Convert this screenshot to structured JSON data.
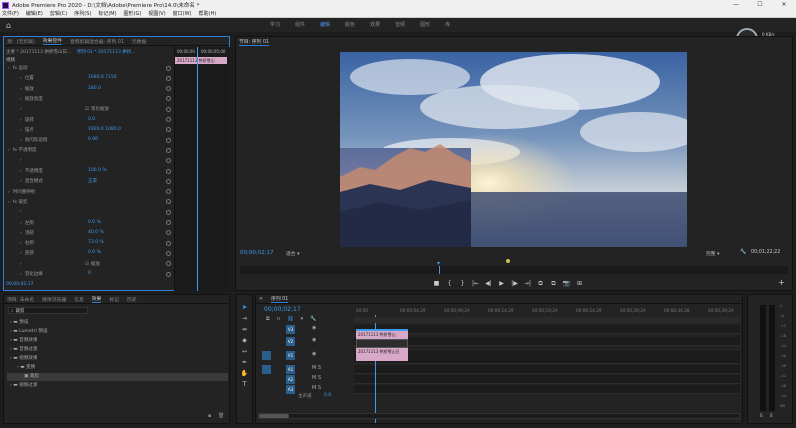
{
  "window": {
    "title": "Adobe Premiere Pro 2020 - D:\\文档\\Adobe\\Premiere Pro\\14.0\\未命名 *",
    "min": "—",
    "max": "☐",
    "close": "✕"
  },
  "menu": [
    "文件(F)",
    "编辑(E)",
    "剪辑(C)",
    "序列(S)",
    "标记(M)",
    "图形(G)",
    "视图(V)",
    "窗口(W)",
    "帮助(H)"
  ],
  "workspace": {
    "home_icon": "home-icon",
    "tabs": [
      "学习",
      "组件",
      "编辑",
      "颜色",
      "效果",
      "音频",
      "图形",
      "库"
    ],
    "active_tab": "编辑",
    "badge": "63",
    "badge_stats": [
      "0 KB/s",
      "0 KB/s"
    ]
  },
  "effect_controls": {
    "tabs": [
      "源：(无剪辑)",
      "效果控件",
      "音频剪辑混合器: 序列 01",
      "元数据"
    ],
    "source_line": "主要 * 20171113 拱桥雪山日...",
    "sequence_line": "序列 01 * 20171113 拱桥...",
    "video_label": "视频",
    "clip_in_timeline": "20171113 拱桥雪山",
    "timecode_in": "00;00;00",
    "timecode_out": "00;00;05;00",
    "rows": [
      {
        "label": "fx  运动",
        "indent": 0,
        "value": ""
      },
      {
        "label": "位置",
        "indent": 1,
        "value": "1680.0    7150"
      },
      {
        "label": "缩放",
        "indent": 1,
        "value": "180.0"
      },
      {
        "label": "缩放宽度",
        "indent": 1,
        "value": ""
      },
      {
        "label": "",
        "indent": 1,
        "value": "",
        "checkbox": "等比缩放"
      },
      {
        "label": "旋转",
        "indent": 1,
        "value": "0.0"
      },
      {
        "label": "锚点",
        "indent": 1,
        "value": "1920.0    1080.0"
      },
      {
        "label": "防闪烁滤镜",
        "indent": 1,
        "value": "0.00"
      },
      {
        "label": "fx  不透明度",
        "indent": 0,
        "value": ""
      },
      {
        "label": "",
        "indent": 1,
        "value": ""
      },
      {
        "label": "不透明度",
        "indent": 1,
        "value": "100.0 %"
      },
      {
        "label": "混合模式",
        "indent": 1,
        "value": "正常"
      },
      {
        "label": "时间重映射",
        "indent": 0,
        "value": ""
      },
      {
        "label": "fx  裁剪",
        "indent": 0,
        "value": ""
      },
      {
        "label": "",
        "indent": 1,
        "value": ""
      },
      {
        "label": "左侧",
        "indent": 1,
        "value": "0.0 %"
      },
      {
        "label": "顶部",
        "indent": 1,
        "value": "40.0 %"
      },
      {
        "label": "右侧",
        "indent": 1,
        "value": "73.0 %"
      },
      {
        "label": "底部",
        "indent": 1,
        "value": "0.0 %"
      },
      {
        "label": "",
        "indent": 1,
        "value": "",
        "checkbox": "缩放"
      },
      {
        "label": "羽化边缘",
        "indent": 1,
        "value": "0"
      }
    ],
    "bottom_time": "00;00;02;17"
  },
  "program": {
    "title": "节目: 序列 01",
    "timecode": "00;00;02;17",
    "fit": "适合",
    "quality": "完整",
    "duration": "00;01;22;22",
    "transport": [
      "■",
      "{",
      "}",
      "|←",
      "◀|",
      "▶",
      "|▶",
      "→|",
      "⧉",
      "⧉",
      "📷",
      "⊞"
    ],
    "add": "+"
  },
  "project": {
    "tabs": [
      "项目: 未命名",
      "媒体浏览器",
      "信息",
      "效果",
      "标记",
      "历史"
    ],
    "search_placeholder": "裁剪",
    "tree": [
      {
        "label": "预设",
        "indent": 0
      },
      {
        "label": "Lumetri 预设",
        "indent": 0
      },
      {
        "label": "音频效果",
        "indent": 0
      },
      {
        "label": "音频过渡",
        "indent": 0
      },
      {
        "label": "视频效果",
        "indent": 0
      },
      {
        "label": "变换",
        "indent": 1
      },
      {
        "label": "裁剪",
        "indent": 2,
        "selected": true
      },
      {
        "label": "视频过渡",
        "indent": 0
      }
    ]
  },
  "timeline": {
    "tab": "序列 01",
    "timecode": "00;00;02;17",
    "ruler": [
      "00;00",
      "00;00;04;29",
      "00;00;09;29",
      "00;00;14;29",
      "00;00;19;29",
      "00;00;24;29",
      "00;00;29;29",
      "00;00;34;28",
      "00;00;39;29"
    ],
    "tracks": [
      "V3",
      "V2",
      "V1",
      "A1",
      "A2",
      "A3"
    ],
    "clips": [
      {
        "name": "20171113 拱桥雪山",
        "track": "V2"
      },
      {
        "name": "20171113 拱桥雪山日",
        "track": "V1"
      }
    ],
    "master_label": "主声道",
    "master_value": "0.0"
  },
  "meter": {
    "labels": [
      "0",
      "-6",
      "-12",
      "-18",
      "-24",
      "-30",
      "-36",
      "-42",
      "-48",
      "-54",
      "dB"
    ],
    "solo": [
      "S",
      "S"
    ]
  },
  "colors": {
    "accent": "#2f7fd8",
    "active_value": "#3e9cf0",
    "clip_pink": "#d8a8c8",
    "playhead": "#3e9cf0"
  }
}
